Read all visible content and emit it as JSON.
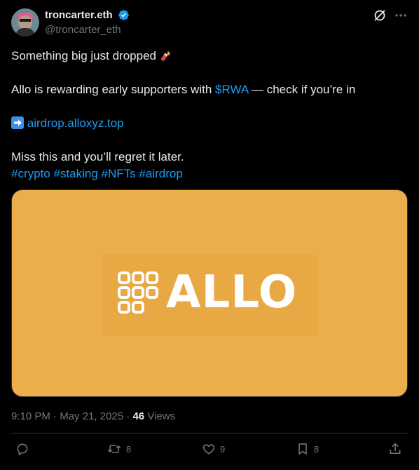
{
  "author": {
    "display_name": "troncarter.eth",
    "handle": "@troncarter_eth",
    "verified": true
  },
  "post": {
    "line1": "Something big just dropped",
    "line2_prefix": "Allo is rewarding early supporters with ",
    "line2_cashtag": "$RWA",
    "line2_suffix": " — check if you’re in",
    "link_text": "airdrop.alloxyz.top",
    "line4": "Miss this and you’ll regret it later.",
    "hashtags": [
      "#crypto",
      "#staking",
      "#NFTs",
      "#airdrop"
    ]
  },
  "media": {
    "logo_text": "ALLO",
    "background_color": "#ecae4b"
  },
  "meta": {
    "time": "9:10 PM",
    "separator": "·",
    "date": "May 21, 2025",
    "views_count": "46",
    "views_label": "Views"
  },
  "actions": {
    "replies": "",
    "reposts": "8",
    "likes": "9",
    "bookmarks": "8"
  },
  "icons": [
    "verified-badge-icon",
    "grok-icon",
    "more-icon",
    "firecracker-emoji",
    "right-arrow-emoji",
    "reply-icon",
    "repost-icon",
    "like-icon",
    "bookmark-icon",
    "share-icon"
  ],
  "colors": {
    "link": "#1d9bf0",
    "muted": "#71767b",
    "text": "#e7e9ea"
  }
}
